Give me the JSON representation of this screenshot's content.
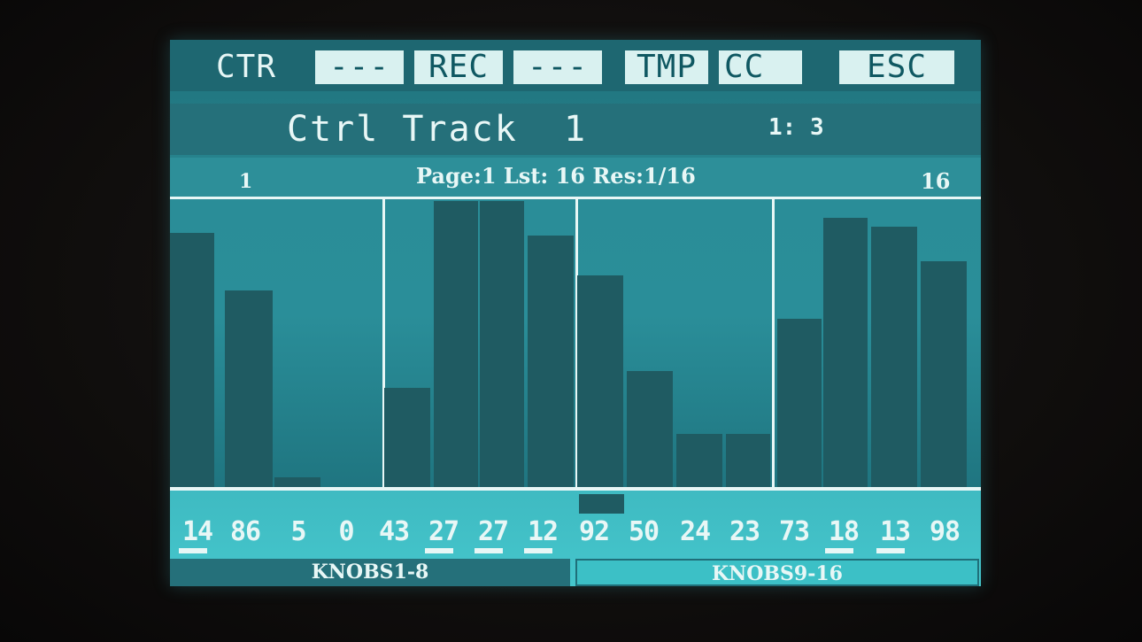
{
  "menu": {
    "ctr": "CTR",
    "slot1": "---",
    "rec": "REC",
    "slot3": "---",
    "tmp": "TMP",
    "cc": "CC",
    "esc": "ESC"
  },
  "title": {
    "name": "Ctrl Track  1",
    "position": "1: 3"
  },
  "info": {
    "first_step": "1",
    "center": "Page:1 Lst: 16 Res:1/16",
    "last_step": "16"
  },
  "steps": {
    "values": [
      14,
      86,
      5,
      0,
      43,
      27,
      27,
      12,
      92,
      50,
      24,
      23,
      73,
      18,
      13,
      98
    ],
    "labels": [
      "14",
      "86",
      "5",
      "0",
      "43",
      "27",
      "27",
      "12",
      "92",
      "50",
      "24",
      "23",
      "73",
      "18",
      "13",
      "98"
    ],
    "bar_levels": [
      0.89,
      0.69,
      0.04,
      0.0,
      0.35,
      1.0,
      1.0,
      0.88,
      0.74,
      0.41,
      0.19,
      0.19,
      0.59,
      0.94,
      0.91,
      0.79
    ],
    "underlined": [
      true,
      false,
      false,
      false,
      false,
      true,
      true,
      true,
      false,
      false,
      false,
      false,
      false,
      true,
      true,
      false
    ],
    "selected_index": 8
  },
  "tabs": {
    "knobs_a": "KNOBS1-8",
    "knobs_b": "KNOBS9-16"
  },
  "colors": {
    "screen_dark": "#1e6771",
    "bar": "#1f5b62",
    "text": "#e8f7f6"
  }
}
